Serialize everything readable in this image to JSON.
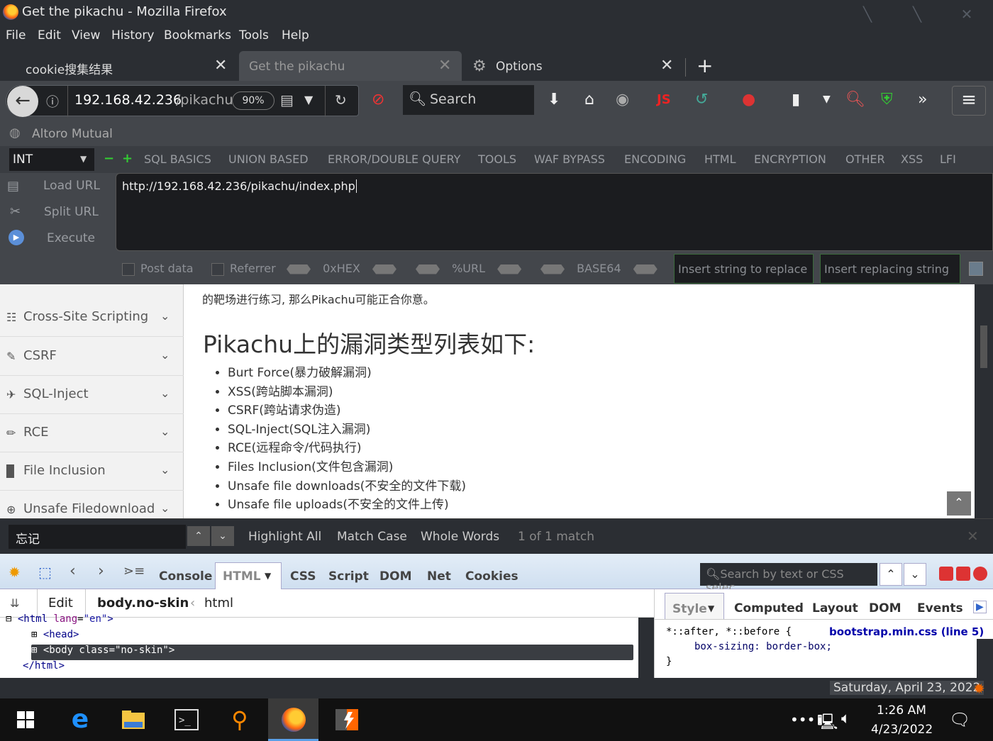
{
  "window": {
    "title": "Get the pikachu - Mozilla Firefox"
  },
  "menu": [
    "File",
    "Edit",
    "View",
    "History",
    "Bookmarks",
    "Tools",
    "Help"
  ],
  "tabs": [
    {
      "label": "cookie搜集结果"
    },
    {
      "label": "Get the pikachu"
    },
    {
      "label": "Options"
    }
  ],
  "nav": {
    "url_host": "192.168.42.236",
    "url_path": "/pikachu",
    "zoom": "90%",
    "search_placeholder": "Search"
  },
  "bookmarks": [
    {
      "label": "Altoro Mutual"
    }
  ],
  "hackbar": {
    "select": "INT",
    "menus": [
      "SQL BASICS",
      "UNION BASED",
      "ERROR/DOUBLE QUERY",
      "TOOLS",
      "WAF BYPASS",
      "ENCODING",
      "HTML",
      "ENCRYPTION",
      "OTHER",
      "XSS",
      "LFI"
    ],
    "load_url": "Load URL",
    "split_url": "Split URL",
    "execute": "Execute",
    "url_value": "http://192.168.42.236/pikachu/index.php",
    "post_data": "Post data",
    "referrer": "Referrer",
    "hex": "0xHEX",
    "urlenc": "%URL",
    "base64": "BASE64",
    "replace_placeholder": "Insert string to replace",
    "replacing_placeholder": "Insert replacing string"
  },
  "sidebar": [
    {
      "label": "Cross-Site Scripting"
    },
    {
      "label": "CSRF"
    },
    {
      "label": "SQL-Inject"
    },
    {
      "label": "RCE"
    },
    {
      "label": "File Inclusion"
    },
    {
      "label": "Unsafe Filedownload"
    }
  ],
  "main": {
    "intro": "的靶场进行练习, 那么Pikachu可能正合你意。",
    "heading": "Pikachu上的漏洞类型列表如下:",
    "vulns": [
      "Burt Force(暴力破解漏洞)",
      "XSS(跨站脚本漏洞)",
      "CSRF(跨站请求伪造)",
      "SQL-Inject(SQL注入漏洞)",
      "RCE(远程命令/代码执行)",
      "Files Inclusion(文件包含漏洞)",
      "Unsafe file downloads(不安全的文件下载)",
      "Unsafe file uploads(不安全的文件上传)"
    ]
  },
  "findbar": {
    "query": "忘记",
    "highlight_all": "Highlight All",
    "match_case": "Match Case",
    "whole_words": "Whole Words",
    "result": "1 of 1 match"
  },
  "firebug": {
    "tabs": [
      "Console",
      "HTML",
      "CSS",
      "Script",
      "DOM",
      "Net",
      "Cookies"
    ],
    "search_placeholder": "Search by text or CSS selec",
    "edit": "Edit",
    "breadcrumb_current": "body.no-skin",
    "breadcrumb_parent": "html",
    "side_tabs": [
      "Style",
      "Computed",
      "Layout",
      "DOM",
      "Events"
    ],
    "style_selector": "*::after, *::before {",
    "style_source": "bootstrap.min.css (line 5)",
    "style_prop": "box-sizing",
    "style_value": "border-box;",
    "style_close": "}"
  },
  "statusbar": {
    "date": "Saturday, April 23, 2022"
  },
  "taskbar": {
    "time": "1:26 AM",
    "date": "4/23/2022"
  }
}
